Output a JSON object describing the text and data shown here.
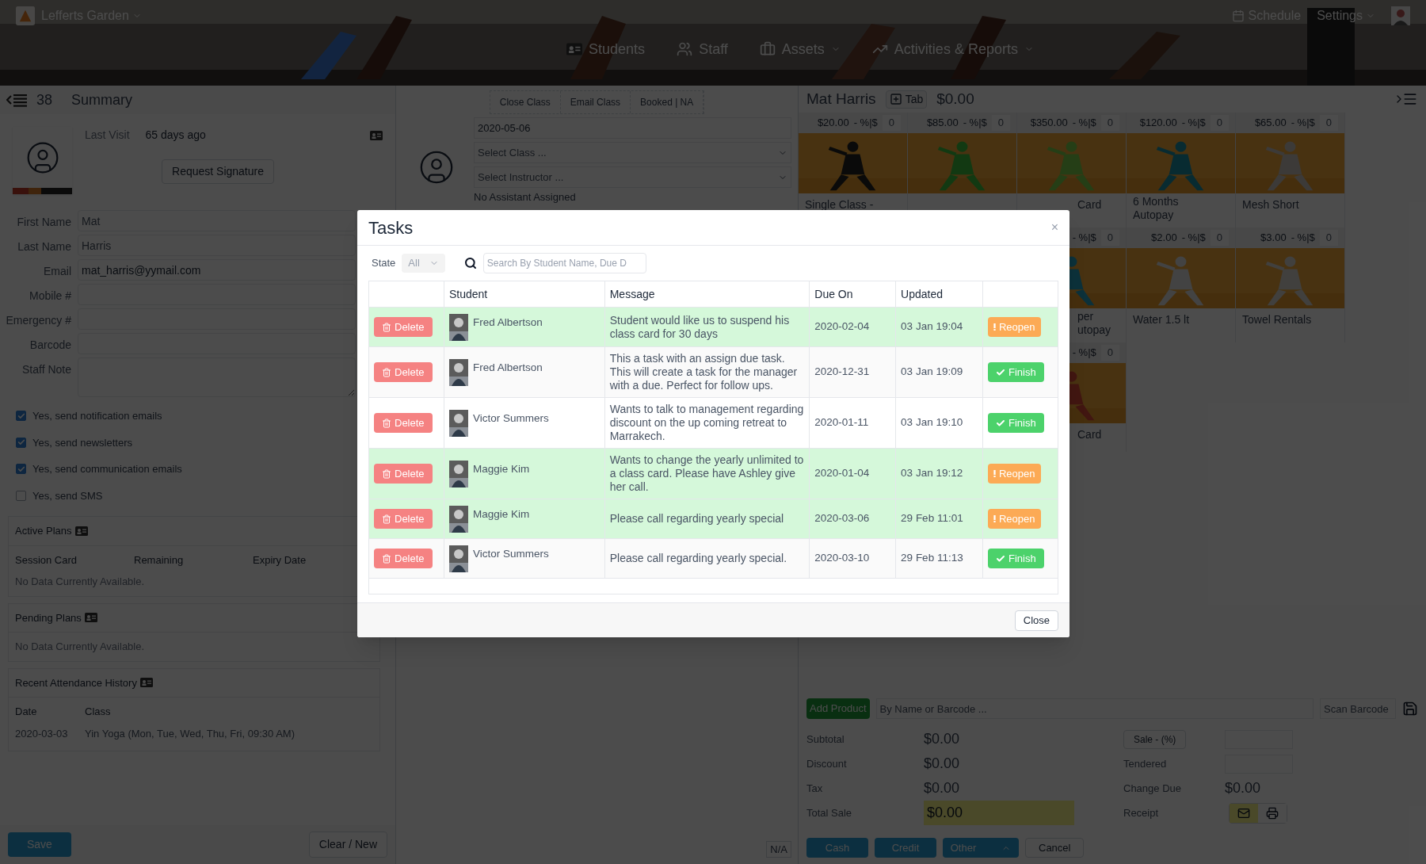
{
  "header": {
    "brand": "Lefferts Garden",
    "nav": [
      {
        "kind": "id",
        "label": "Students",
        "dropdown": false
      },
      {
        "kind": "users",
        "label": "Staff",
        "dropdown": false
      },
      {
        "kind": "briefcase",
        "label": "Assets",
        "dropdown": true
      },
      {
        "kind": "chart",
        "label": "Activities & Reports",
        "dropdown": true
      }
    ],
    "schedule": "Schedule",
    "settings": "Settings"
  },
  "summary": {
    "count": "38",
    "title": "Summary",
    "last_visit_label": "Last Visit",
    "last_visit": "65 days ago",
    "signature_button": "Request Signature",
    "fields": [
      {
        "label": "First Name",
        "placeholder": "Mat",
        "kind": "input"
      },
      {
        "label": "Last Name",
        "placeholder": "Harris",
        "kind": "input"
      },
      {
        "label": "Email",
        "value": "mat_harris@yymail.com",
        "kind": "input"
      },
      {
        "label": "Mobile #",
        "kind": "input"
      },
      {
        "label": "Emergency #",
        "kind": "input"
      },
      {
        "label": "Barcode",
        "kind": "input"
      },
      {
        "label": "Staff Note",
        "kind": "textarea"
      }
    ],
    "options": [
      {
        "label": "Yes, send notification emails",
        "checked": true
      },
      {
        "label": "Yes, send newsletters",
        "checked": true
      },
      {
        "label": "Yes, send communication emails",
        "checked": true
      },
      {
        "label": "Yes, send SMS",
        "checked": false
      }
    ],
    "active_plans": {
      "title": "Active Plans",
      "columns": [
        "Session Card",
        "Remaining",
        "Expiry Date"
      ],
      "empty": "No Data Currently Available."
    },
    "pending_plans": {
      "title": "Pending Plans",
      "empty": "No Data Currently Available."
    },
    "attendance": {
      "title": "Recent Attendance History",
      "columns": [
        "Date",
        "Class"
      ],
      "rows": [
        [
          "2020-03-03",
          "Yin Yoga (Mon, Tue, Wed, Thu, Fri, 09:30 AM)"
        ]
      ]
    },
    "save": "Save",
    "clear": "Clear / New"
  },
  "class_panel": {
    "actions": [
      "Close Class",
      "Email Class",
      "Booked | NA"
    ],
    "date": "2020-05-06",
    "class_placeholder": "Select Class ...",
    "instructor_placeholder": "Select Instructor ...",
    "assistant": "No Assistant Assigned",
    "footer": "N/A"
  },
  "sale": {
    "customer": "Mat Harris",
    "tab_button": "Tab",
    "balance": "$0.00",
    "product_rows": [
      [
        {
          "kind": "full",
          "price": "$20.00",
          "discount": "- %|$",
          "qty": "0",
          "label": [
            "Single Class -"
          ]
        },
        {
          "kind": "full",
          "price": "$85.00",
          "discount": "- %|$",
          "qty": "0"
        },
        {
          "kind": "partial",
          "price": "$350.00",
          "discount": "- %|$",
          "qty": "0",
          "label": [
            "Card"
          ]
        },
        {
          "kind": "full",
          "price": "$120.00",
          "discount": "- %|$",
          "qty": "0",
          "label": [
            "6 Months",
            "Autopay"
          ]
        },
        {
          "kind": "full",
          "price": "$65.00",
          "discount": "- %|$",
          "qty": "0",
          "label": [
            "Mesh Short"
          ]
        }
      ],
      [
        {
          "kind": "partial",
          "discount": "- %|$",
          "qty": "0",
          "label": [
            "per",
            "utopay"
          ]
        },
        {
          "kind": "full",
          "price": "$2.00",
          "discount": "- %|$",
          "qty": "0",
          "label": [
            "Water 1.5 lt"
          ]
        },
        {
          "kind": "full",
          "price": "$3.00",
          "discount": "- %|$",
          "qty": "0",
          "label": [
            "Towel Rentals"
          ]
        }
      ],
      [
        {
          "kind": "partial",
          "discount": "- %|$",
          "qty": "0",
          "label": [
            "Card"
          ]
        }
      ]
    ]
  },
  "checkout": {
    "add_button": "Add Product",
    "search_placeholder": "By Name or Barcode ...",
    "scan_placeholder": "Scan Barcode",
    "totals": [
      {
        "label": "Subtotal",
        "value": "$0.00",
        "highlighted": false
      },
      {
        "label": "Discount",
        "value": "$0.00",
        "highlighted": false
      },
      {
        "label": "Tax",
        "value": "$0.00",
        "highlighted": false
      },
      {
        "label": "Total Sale",
        "value": "$0.00",
        "highlighted": true
      }
    ],
    "sale_button": "Sale - (%)",
    "tendered_label": "Tendered",
    "change_label": "Change Due",
    "change_value": "$0.00",
    "receipt_label": "Receipt",
    "receipt_options": [
      {
        "kind": "email",
        "selected": true
      },
      {
        "kind": "print",
        "selected": false
      }
    ],
    "payments": [
      "Cash",
      "Credit",
      "Other"
    ],
    "cancel": "Cancel"
  },
  "tasks_modal": {
    "title": "Tasks",
    "close_x": "×",
    "state_label": "State",
    "state_value": "All",
    "search_placeholder": "Search By Student Name, Due D",
    "columns": [
      "Student",
      "Message",
      "Due On",
      "Updated"
    ],
    "rows": [
      {
        "delete": "Delete",
        "student": "Fred Albertson",
        "message": "Student would like us to suspend his class card for 30 days",
        "due": "2020-02-04",
        "updated": "03 Jan 19:04",
        "completed": true,
        "action": "Reopen"
      },
      {
        "delete": "Delete",
        "student": "Fred Albertson",
        "message": "This a task with an assign due task. This will create a task for the manager with a due. Perfect for follow ups.",
        "due": "2020-12-31",
        "updated": "03 Jan 19:09",
        "completed": false,
        "action": "Finish"
      },
      {
        "delete": "Delete",
        "student": "Victor Summers",
        "message": "Wants to talk to management regarding discount on the up coming retreat to Marrakech.",
        "due": "2020-01-11",
        "updated": "03 Jan 19:10",
        "completed": false,
        "action": "Finish"
      },
      {
        "delete": "Delete",
        "student": "Maggie Kim",
        "message": "Wants to change the yearly unlimited to a class card. Please have Ashley give her call.",
        "due": "2020-01-04",
        "updated": "03 Jan 19:12",
        "completed": true,
        "action": "Reopen"
      },
      {
        "delete": "Delete",
        "student": "Maggie Kim",
        "message": "Please call regarding yearly special",
        "due": "2020-03-06",
        "updated": "29 Feb 11:01",
        "completed": true,
        "action": "Reopen"
      },
      {
        "delete": "Delete",
        "student": "Victor Summers",
        "message": "Please call regarding yearly special.",
        "due": "2020-03-10",
        "updated": "29 Feb 11:13",
        "completed": false,
        "action": "Finish"
      }
    ],
    "close": "Close"
  }
}
